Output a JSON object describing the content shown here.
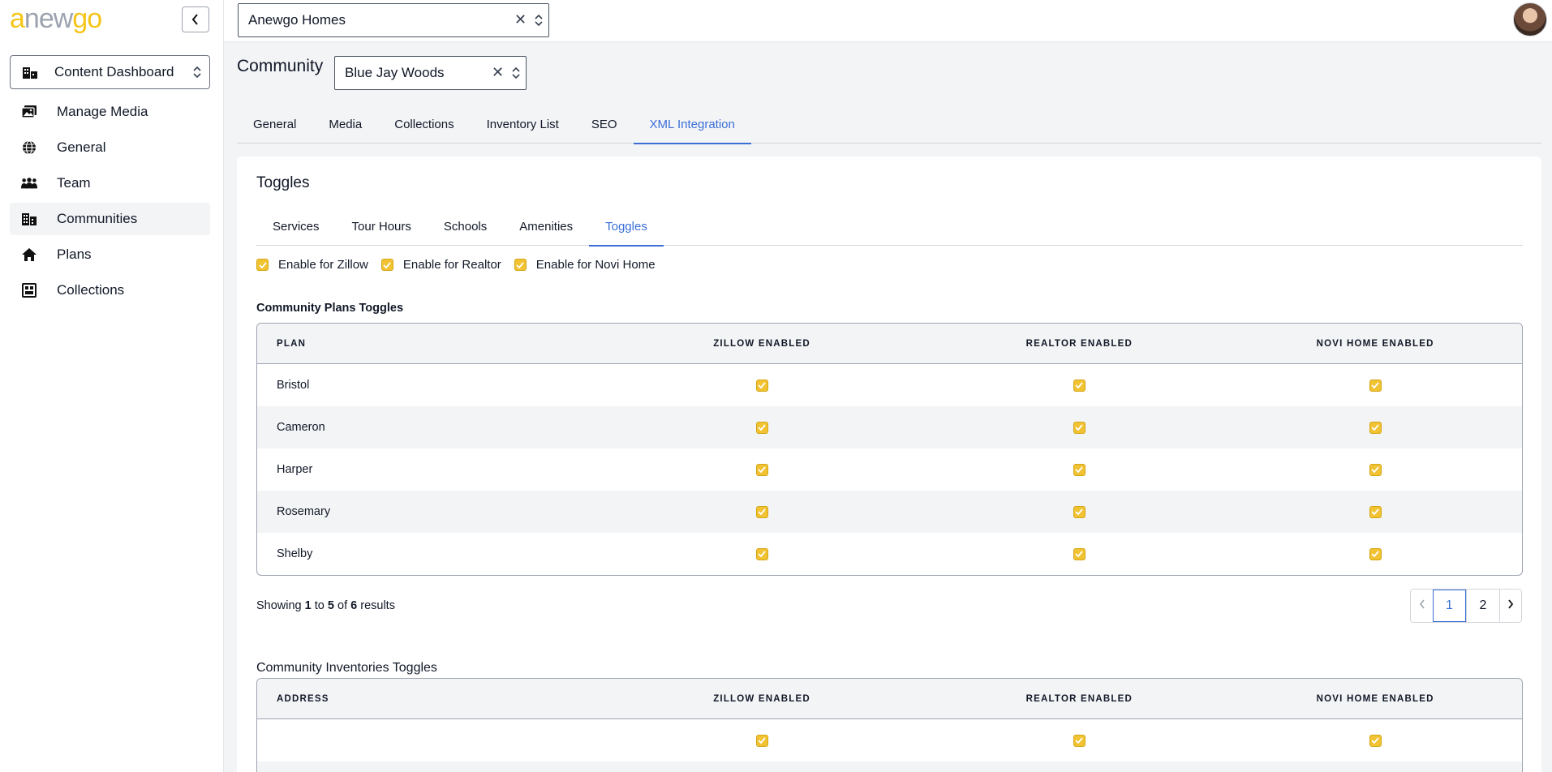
{
  "brand": {
    "logo_parts": [
      "a",
      "new",
      "go"
    ],
    "accent": "#f5c518",
    "link_color": "#3b6fd8"
  },
  "sidebar": {
    "dashboard_select": "Content Dashboard",
    "items": [
      {
        "label": "Manage Media",
        "icon": "media-icon"
      },
      {
        "label": "General",
        "icon": "globe-icon"
      },
      {
        "label": "Team",
        "icon": "team-icon"
      },
      {
        "label": "Communities",
        "icon": "buildings-icon",
        "active": true
      },
      {
        "label": "Plans",
        "icon": "home-icon"
      },
      {
        "label": "Collections",
        "icon": "collection-icon"
      }
    ]
  },
  "topbar": {
    "company_value": "Anewgo Homes"
  },
  "community": {
    "label": "Community",
    "value": "Blue Jay Woods"
  },
  "top_tabs": [
    {
      "label": "General"
    },
    {
      "label": "Media"
    },
    {
      "label": "Collections"
    },
    {
      "label": "Inventory List"
    },
    {
      "label": "SEO"
    },
    {
      "label": "XML Integration",
      "active": true
    }
  ],
  "card": {
    "title": "Toggles",
    "inner_tabs": [
      {
        "label": "Services"
      },
      {
        "label": "Tour Hours"
      },
      {
        "label": "Schools"
      },
      {
        "label": "Amenities"
      },
      {
        "label": "Toggles",
        "active": true
      }
    ],
    "enable_checks": [
      {
        "label": "Enable for Zillow",
        "checked": true
      },
      {
        "label": "Enable for Realtor",
        "checked": true
      },
      {
        "label": "Enable for Novi Home",
        "checked": true
      }
    ]
  },
  "plans_table": {
    "title": "Community Plans Toggles",
    "headers": [
      "Plan",
      "Zillow Enabled",
      "Realtor Enabled",
      "Novi Home Enabled"
    ],
    "rows": [
      {
        "name": "Bristol",
        "zillow": true,
        "realtor": true,
        "novi": true
      },
      {
        "name": "Cameron",
        "zillow": true,
        "realtor": true,
        "novi": true
      },
      {
        "name": "Harper",
        "zillow": true,
        "realtor": true,
        "novi": true
      },
      {
        "name": "Rosemary",
        "zillow": true,
        "realtor": true,
        "novi": true
      },
      {
        "name": "Shelby",
        "zillow": true,
        "realtor": true,
        "novi": true
      }
    ],
    "showing": {
      "prefix": "Showing",
      "from": "1",
      "to_word": "to",
      "to": "5",
      "of_word": "of",
      "total": "6",
      "suffix": "results"
    },
    "pages": [
      "1",
      "2"
    ],
    "current_page": "1"
  },
  "inventories_table": {
    "title": "Community Inventories Toggles",
    "headers": [
      "Address",
      "Zillow Enabled",
      "Realtor Enabled",
      "Novi Home Enabled"
    ],
    "rows": [
      {
        "name": "",
        "zillow": true,
        "realtor": true,
        "novi": true
      },
      {
        "name": "",
        "zillow": true,
        "realtor": true,
        "novi": true
      }
    ]
  }
}
